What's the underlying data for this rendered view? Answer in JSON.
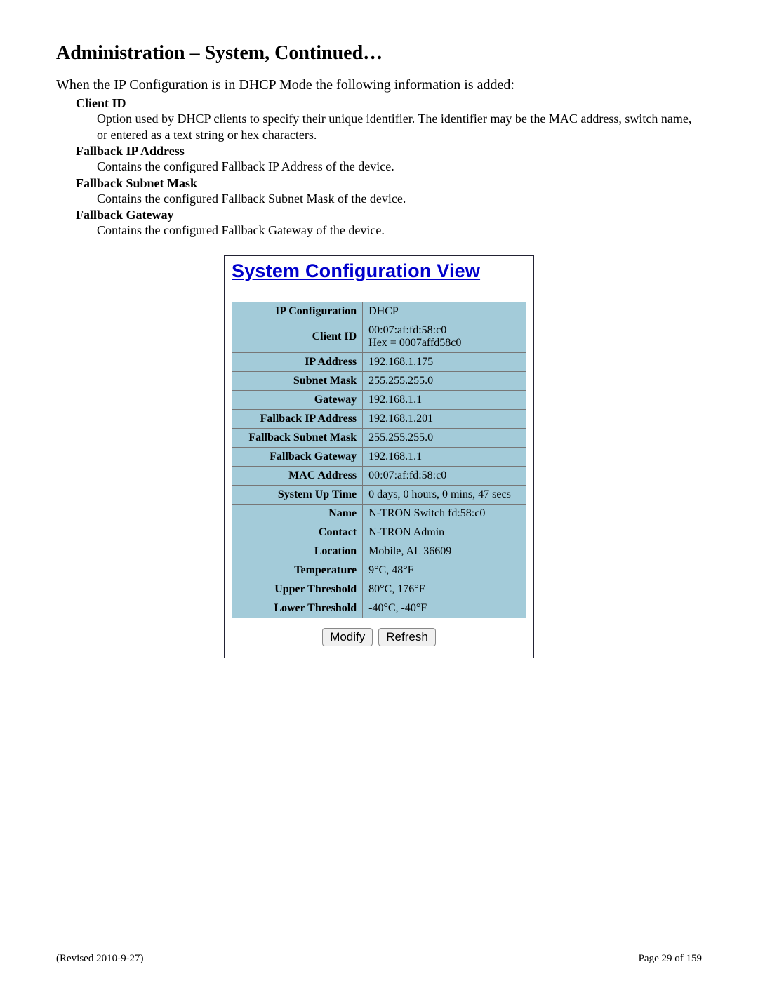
{
  "heading": "Administration – System, Continued…",
  "intro": "When the IP Configuration is in DHCP Mode the following information is added:",
  "definitions": [
    {
      "term": "Client ID",
      "desc": "Option used by DHCP clients to specify their unique identifier. The identifier may be the MAC address, switch name, or entered as a text string or hex characters."
    },
    {
      "term": "Fallback IP Address",
      "desc": "Contains the configured Fallback IP Address of the device."
    },
    {
      "term": "Fallback Subnet Mask",
      "desc": "Contains the configured Fallback Subnet Mask of the device."
    },
    {
      "term": "Fallback Gateway",
      "desc": "Contains the configured Fallback Gateway of the device."
    }
  ],
  "panel": {
    "title": "System Configuration View",
    "rows": [
      {
        "label": "IP Configuration",
        "value": "DHCP"
      },
      {
        "label": "Client ID",
        "value": "00:07:af:fd:58:c0\nHex = 0007affd58c0"
      },
      {
        "label": "IP Address",
        "value": "192.168.1.175"
      },
      {
        "label": "Subnet Mask",
        "value": "255.255.255.0"
      },
      {
        "label": "Gateway",
        "value": "192.168.1.1"
      },
      {
        "label": "Fallback IP Address",
        "value": "192.168.1.201"
      },
      {
        "label": "Fallback Subnet Mask",
        "value": "255.255.255.0"
      },
      {
        "label": "Fallback Gateway",
        "value": "192.168.1.1"
      },
      {
        "label": "MAC Address",
        "value": "00:07:af:fd:58:c0"
      },
      {
        "label": "System Up Time",
        "value": "0 days, 0 hours, 0 mins, 47 secs"
      },
      {
        "label": "Name",
        "value": "N-TRON Switch fd:58:c0"
      },
      {
        "label": "Contact",
        "value": "N-TRON Admin"
      },
      {
        "label": "Location",
        "value": "Mobile, AL 36609"
      },
      {
        "label": "Temperature",
        "value": "9°C, 48°F"
      },
      {
        "label": "Upper Threshold",
        "value": "80°C, 176°F"
      },
      {
        "label": "Lower Threshold",
        "value": "-40°C, -40°F"
      }
    ],
    "buttons": {
      "modify": "Modify",
      "refresh": "Refresh"
    }
  },
  "footer": {
    "left": "(Revised 2010-9-27)",
    "right": "Page 29 of 159"
  }
}
